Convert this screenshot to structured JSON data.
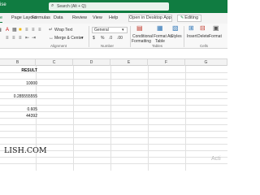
{
  "app": {
    "title": "ise",
    "search_placeholder": "Search (Alt + Q)",
    "open_desktop_label": "Open in Desktop App",
    "editing_label": "Editing",
    "accent_color": "#107c41"
  },
  "tabs": [
    {
      "label": "e"
    },
    {
      "label": "Page Layout"
    },
    {
      "label": "Formulas"
    },
    {
      "label": "Data"
    },
    {
      "label": "Review"
    },
    {
      "label": "View"
    },
    {
      "label": "Help"
    }
  ],
  "ribbon": {
    "wrap_text": "Wrap Text",
    "merge_center": "Merge & Center",
    "alignment_group": "Alignment",
    "number_format": "General",
    "currency_symbol": "$",
    "percent_symbol": "%",
    "number_group": "Number",
    "conditional_formatting": [
      "Conditional",
      "Formatting"
    ],
    "format_as_table": [
      "Format As",
      "Table"
    ],
    "styles": "Styles",
    "tables_group": "Tables",
    "insert": "Insert",
    "delete": "Delete",
    "format": "Format",
    "cells_group": "Cells"
  },
  "columns": [
    "B",
    "C",
    "D",
    "E",
    "F",
    "G"
  ],
  "cells": {
    "header": "RESULT",
    "values": [
      "10000",
      "0.285555555",
      "0.605",
      "44392"
    ]
  },
  "watermark": "LISH.COM",
  "activate_text": "Acti"
}
